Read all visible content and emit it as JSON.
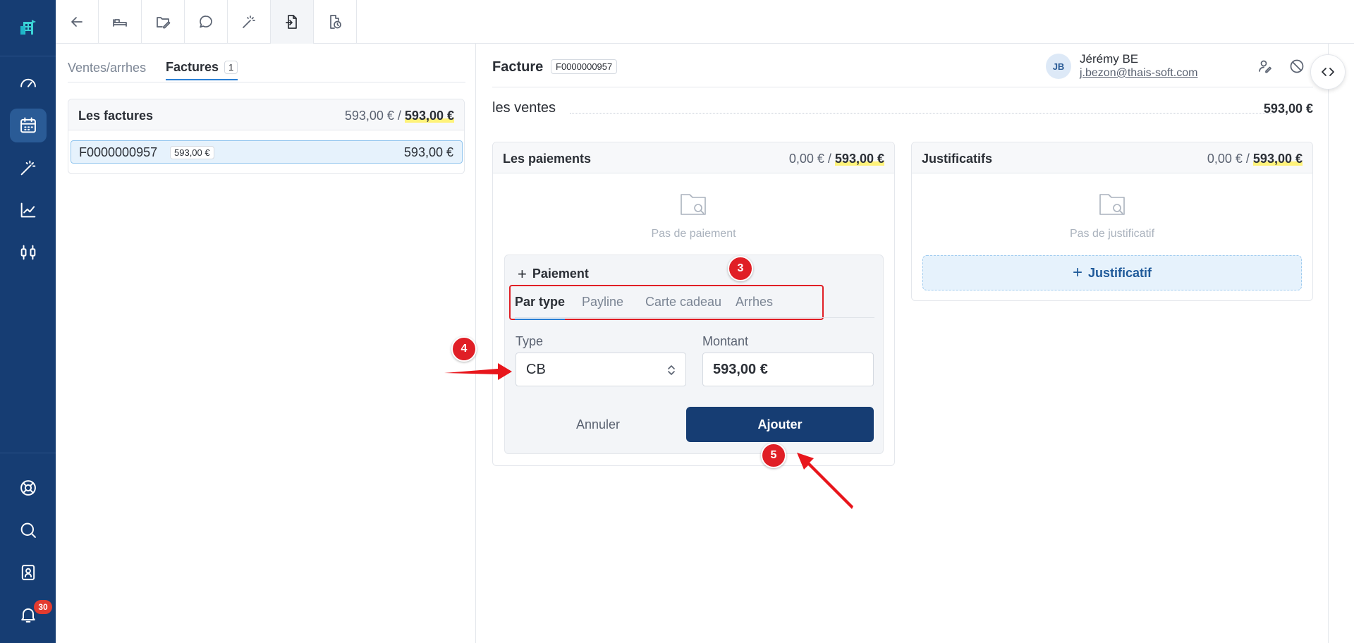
{
  "left": {
    "tabs": [
      {
        "label": "Ventes/arrhes"
      },
      {
        "label": "Factures",
        "count": "1"
      }
    ],
    "invoices_card": {
      "title": "Les factures",
      "amount_prefix": "593,00 € /",
      "amount_total": "593,00 €",
      "row": {
        "number": "F0000000957",
        "small_amount": "593,00 €",
        "amount": "593,00 €"
      }
    }
  },
  "invoice": {
    "title": "Facture",
    "code": "F0000000957",
    "user": {
      "initials": "JB",
      "name": "Jérémy BE",
      "email": "j.bezon@thais-soft.com"
    },
    "sales_label": "les ventes",
    "sales_amount": "593,00 €"
  },
  "payments": {
    "title": "Les paiements",
    "amount_prefix": "0,00 € /",
    "amount_total": "593,00 €",
    "empty_text": "Pas de paiement",
    "form": {
      "title": "Paiement",
      "tabs": [
        "Par type",
        "Payline",
        "Carte cadeau",
        "Arrhes"
      ],
      "type_label": "Type",
      "type_value": "CB",
      "amount_label": "Montant",
      "amount_value": "593,00 €",
      "cancel_label": "Annuler",
      "add_label": "Ajouter"
    }
  },
  "justificatifs": {
    "title": "Justificatifs",
    "amount_prefix": "0,00 € /",
    "amount_total": "593,00 €",
    "empty_text": "Pas de justificatif",
    "add_label": "Justificatif"
  },
  "notifications": {
    "count": "30"
  },
  "annotations": {
    "m3": "3",
    "m4": "4",
    "m5": "5"
  },
  "colors": {
    "sidebar": "#163d73",
    "primary_button": "#163d73",
    "annotation": "#e01f26",
    "highlight": "#fff27a",
    "accent_tab": "#2a7fd4"
  },
  "icons": {
    "sidebar": [
      "hotel-logo-icon",
      "dashboard-gauge-icon",
      "calendar-icon",
      "magic-wand-icon",
      "chart-line-icon",
      "sliders-icon",
      "lifebuoy-icon",
      "search-icon",
      "contact-card-icon",
      "bell-icon"
    ],
    "toolbar": [
      "arrow-left-icon",
      "bed-icon",
      "folder-edit-icon",
      "chat-bubble-icon",
      "magic-wand-icon",
      "file-import-icon",
      "file-clock-icon"
    ]
  }
}
